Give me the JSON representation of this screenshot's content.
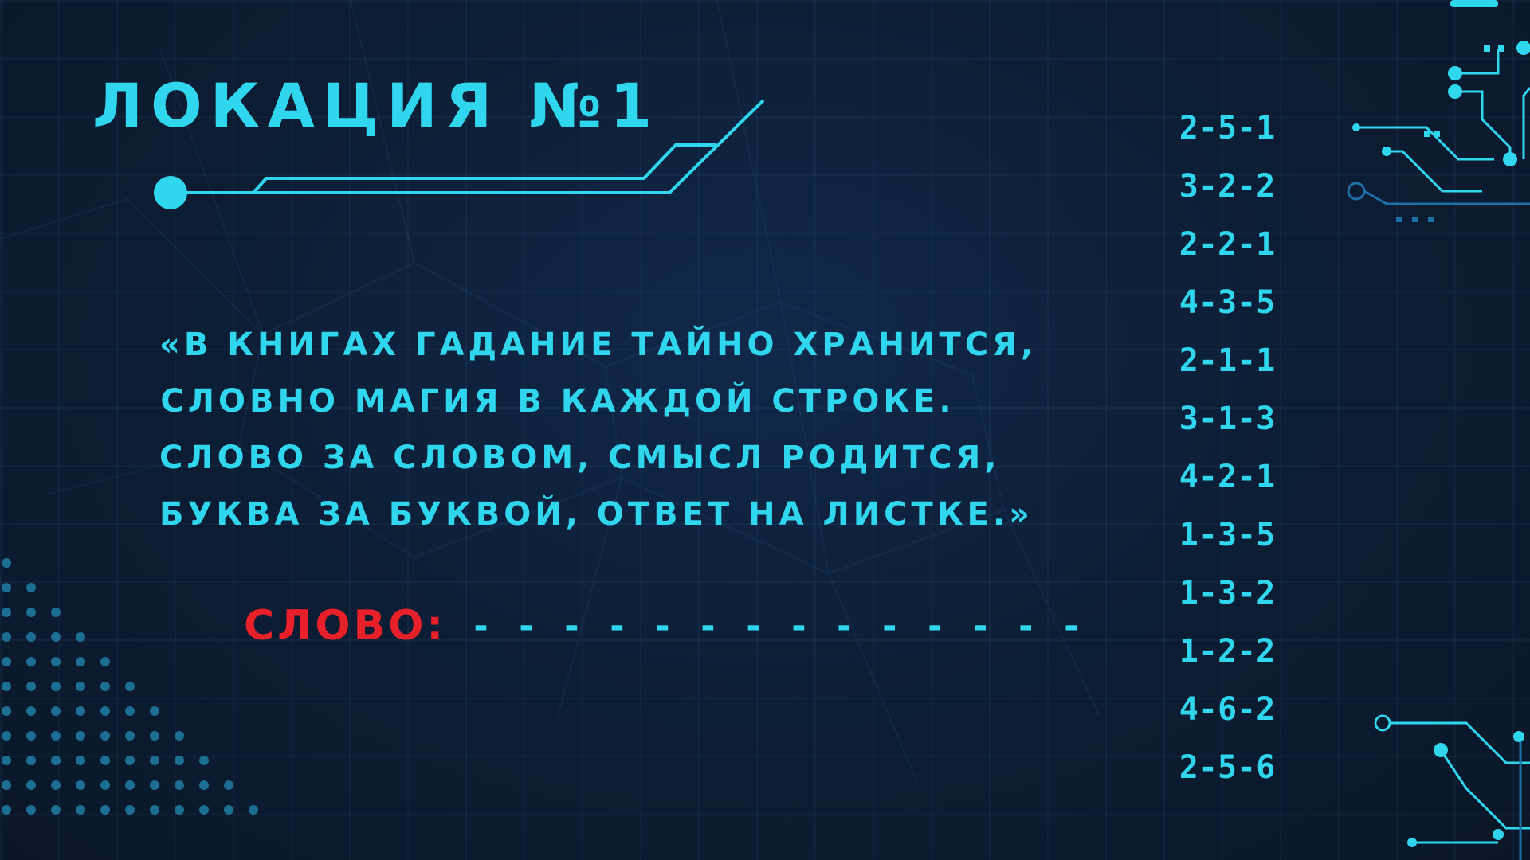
{
  "title": "ЛОКАЦИЯ №1",
  "poem": {
    "lines": [
      "«В книгах гадание тайно хранится,",
      "словно магия в каждой строке.",
      "Слово за словом, смысл родится,",
      "буква за буквой, ответ на листке.»"
    ]
  },
  "answer": {
    "label": "СЛОВО:",
    "blanks": "- - - - - - - - - - - - - -"
  },
  "codes": [
    "2-5-1",
    "3-2-2",
    "2-2-1",
    "4-3-5",
    "2-1-1",
    "3-1-3",
    "4-2-1",
    "1-3-5",
    "1-3-2",
    "1-2-2",
    "4-6-2",
    "2-5-6"
  ],
  "colors": {
    "background": "#0c1d33",
    "accent": "#2fd6ee",
    "highlight": "#e8202a"
  }
}
